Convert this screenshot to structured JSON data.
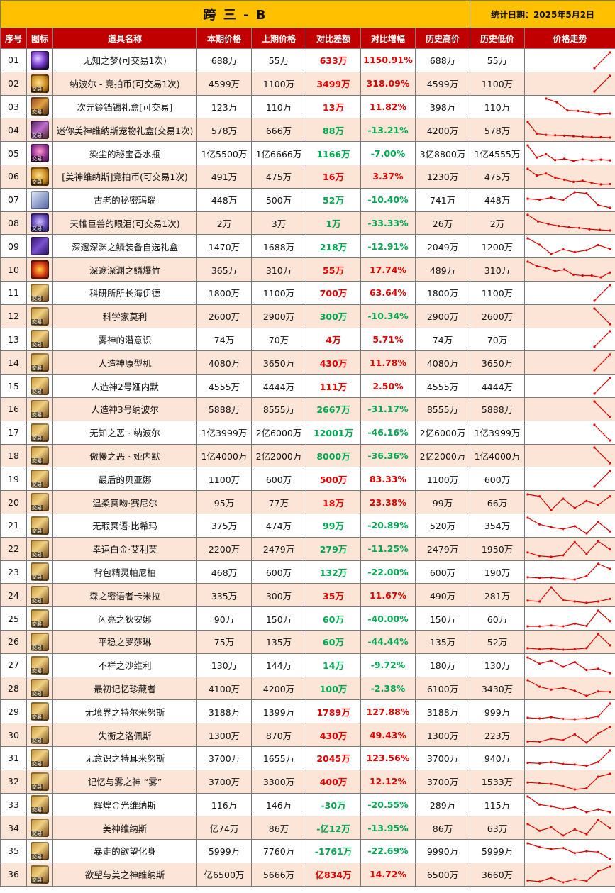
{
  "sheet": {
    "title": "跨 三 - B",
    "date_label": "统计日期：2025年5月2日"
  },
  "header": {
    "no": "序号",
    "icon": "图标",
    "name": "道具名称",
    "cur": "本期价格",
    "prev": "上期价格",
    "diff": "对比差额",
    "pct": "对比增幅",
    "high": "历史高价",
    "low": "历史低价",
    "trend": "价格走势"
  },
  "colors": {
    "up": "#e00000",
    "down": "#00a650",
    "header": "#c00000",
    "title": "#ffc000",
    "alt_row": "#fce4d6",
    "trend_line": "#e00000"
  },
  "icon_tag": "交易",
  "rows": [
    {
      "no": "01",
      "name": "无知之梦(可交易1次)",
      "cur": "688万",
      "prev": "55万",
      "diff": "633万",
      "pct": "1150.91%",
      "high": "688万",
      "low": "55万",
      "dir": "up",
      "icon": "orb-icon",
      "trend": [
        55,
        688
      ]
    },
    {
      "no": "02",
      "name": "纳波尔 - 竞拍币(可交易1次)",
      "cur": "4599万",
      "prev": "1100万",
      "diff": "3499万",
      "pct": "318.09%",
      "high": "4599万",
      "low": "1100万",
      "dir": "up",
      "icon": "coin-icon",
      "trend": [
        1100,
        4599
      ]
    },
    {
      "no": "03",
      "name": "次元铃铛镯礼盒[可交易]",
      "cur": "123万",
      "prev": "110万",
      "diff": "13万",
      "pct": "11.82%",
      "high": "398万",
      "low": "110万",
      "dir": "up",
      "icon": "box-icon",
      "trend": [
        398,
        330,
        180,
        170,
        140,
        110,
        123
      ]
    },
    {
      "no": "04",
      "name": "迷你美神维纳斯宠物礼盒(交易1次)",
      "cur": "578万",
      "prev": "666万",
      "diff": "88万",
      "pct": "-13.21%",
      "high": "4200万",
      "low": "578万",
      "dir": "down",
      "icon": "pet-box-icon",
      "trend": [
        4200,
        1500,
        1200,
        1100,
        1000,
        900,
        800,
        700,
        666,
        578
      ]
    },
    {
      "no": "05",
      "name": "染尘的秘宝香水瓶",
      "cur": "1亿5500万",
      "prev": "1亿6666万",
      "diff": "1166万",
      "pct": "-7.00%",
      "high": "3亿8800万",
      "low": "1亿4555万",
      "dir": "down",
      "icon": "bottle-icon",
      "trend": [
        38800,
        20000,
        25000,
        16000,
        18000,
        14555,
        17000,
        15500,
        16666,
        15500
      ]
    },
    {
      "no": "06",
      "name": "[美神维纳斯]竞拍币(可交易1次)",
      "cur": "491万",
      "prev": "475万",
      "diff": "16万",
      "pct": "3.37%",
      "high": "1230万",
      "low": "475万",
      "dir": "up",
      "icon": "coin-icon",
      "trend": [
        1230,
        900,
        1000,
        800,
        700,
        600,
        650,
        550,
        475,
        491
      ]
    },
    {
      "no": "07",
      "name": "古老的秘密玛瑙",
      "cur": "448万",
      "prev": "500万",
      "diff": "52万",
      "pct": "-10.40%",
      "high": "741万",
      "low": "448万",
      "dir": "down",
      "icon": "gem-icon",
      "trend": [
        620,
        600,
        640,
        590,
        741,
        720,
        500,
        448
      ]
    },
    {
      "no": "08",
      "name": "天帷巨兽的眼泪(可交易1次)",
      "cur": "2万",
      "prev": "3万",
      "diff": "1万",
      "pct": "-33.33%",
      "high": "26万",
      "low": "2万",
      "dir": "down",
      "icon": "tear-icon",
      "trend": [
        26,
        16,
        12,
        9,
        7,
        6,
        4,
        3,
        2
      ]
    },
    {
      "no": "09",
      "name": "深邃深渊之鳞装备自选礼盒",
      "cur": "1470万",
      "prev": "1688万",
      "diff": "218万",
      "pct": "-12.91%",
      "high": "2049万",
      "low": "1200万",
      "dir": "down",
      "icon": "chest-icon",
      "trend": [
        2049,
        1700,
        1200,
        1450,
        1300,
        1400,
        1688,
        1470
      ]
    },
    {
      "no": "10",
      "name": "深邃深渊之鳞爆竹",
      "cur": "365万",
      "prev": "310万",
      "diff": "55万",
      "pct": "17.74%",
      "high": "489万",
      "low": "310万",
      "dir": "up",
      "icon": "fire-icon",
      "trend": [
        489,
        440,
        420,
        380,
        400,
        340,
        330,
        330,
        310,
        365
      ]
    },
    {
      "no": "11",
      "name": "科研所所长海伊德",
      "cur": "1800万",
      "prev": "1100万",
      "diff": "700万",
      "pct": "63.64%",
      "high": "1800万",
      "low": "1100万",
      "dir": "up",
      "icon": "card-icon",
      "trend": [
        1100,
        1800
      ]
    },
    {
      "no": "12",
      "name": "科学家莫利",
      "cur": "2600万",
      "prev": "2900万",
      "diff": "300万",
      "pct": "-10.34%",
      "high": "2900万",
      "low": "2600万",
      "dir": "down",
      "icon": "card-icon",
      "trend": [
        2900,
        2600
      ]
    },
    {
      "no": "13",
      "name": "雾神的潜意识",
      "cur": "74万",
      "prev": "70万",
      "diff": "4万",
      "pct": "5.71%",
      "high": "74万",
      "low": "70万",
      "dir": "up",
      "icon": "card-icon",
      "trend": [
        70,
        74
      ]
    },
    {
      "no": "14",
      "name": "人造神原型机",
      "cur": "4080万",
      "prev": "3650万",
      "diff": "430万",
      "pct": "11.78%",
      "high": "4080万",
      "low": "3650万",
      "dir": "up",
      "icon": "card-icon",
      "trend": [
        3650,
        4080
      ]
    },
    {
      "no": "15",
      "name": "人造神2号娅内默",
      "cur": "4555万",
      "prev": "4444万",
      "diff": "111万",
      "pct": "2.50%",
      "high": "4555万",
      "low": "4444万",
      "dir": "up",
      "icon": "card-icon",
      "trend": [
        4444,
        4555
      ]
    },
    {
      "no": "16",
      "name": "人造神3号纳波尔",
      "cur": "5888万",
      "prev": "8555万",
      "diff": "2667万",
      "pct": "-31.17%",
      "high": "8555万",
      "low": "5888万",
      "dir": "down",
      "icon": "card-icon",
      "trend": [
        8555,
        5888
      ]
    },
    {
      "no": "17",
      "name": "无知之恶 · 纳波尔",
      "cur": "1亿3999万",
      "prev": "2亿6000万",
      "diff": "12001万",
      "pct": "-46.16%",
      "high": "2亿6000万",
      "low": "1亿3999万",
      "dir": "down",
      "icon": "card-icon",
      "trend": [
        26000,
        13999
      ]
    },
    {
      "no": "18",
      "name": "傲慢之恶 · 娅内默",
      "cur": "1亿4000万",
      "prev": "2亿2000万",
      "diff": "8000万",
      "pct": "-36.36%",
      "high": "2亿2000万",
      "low": "1亿4000万",
      "dir": "down",
      "icon": "card-icon",
      "trend": [
        22000,
        14000
      ]
    },
    {
      "no": "19",
      "name": "最后的贝亚娜",
      "cur": "1100万",
      "prev": "600万",
      "diff": "500万",
      "pct": "83.33%",
      "high": "1100万",
      "low": "600万",
      "dir": "up",
      "icon": "card-icon",
      "trend": [
        600,
        1100
      ]
    },
    {
      "no": "20",
      "name": "温柔冥吻·赛尼尔",
      "cur": "95万",
      "prev": "77万",
      "diff": "18万",
      "pct": "23.38%",
      "high": "99万",
      "low": "66万",
      "dir": "up",
      "icon": "card-icon",
      "trend": [
        99,
        95,
        66,
        90,
        70,
        85,
        77,
        95
      ]
    },
    {
      "no": "21",
      "name": "无瑕冥语·比希玛",
      "cur": "375万",
      "prev": "474万",
      "diff": "99万",
      "pct": "-20.89%",
      "high": "520万",
      "low": "354万",
      "dir": "down",
      "icon": "card-icon",
      "trend": [
        520,
        450,
        420,
        400,
        430,
        354,
        474,
        375
      ]
    },
    {
      "no": "22",
      "name": "幸运白金·艾利芙",
      "cur": "2200万",
      "prev": "2479万",
      "diff": "279万",
      "pct": "-11.25%",
      "high": "2479万",
      "low": "1950万",
      "dir": "down",
      "icon": "card-icon",
      "trend": [
        2100,
        1980,
        1950,
        2000,
        2450,
        2050,
        2479,
        2200
      ]
    },
    {
      "no": "23",
      "name": "背包精灵帕尼柏",
      "cur": "468万",
      "prev": "600万",
      "diff": "132万",
      "pct": "-22.00%",
      "high": "600万",
      "low": "190万",
      "dir": "down",
      "icon": "card-icon",
      "trend": [
        250,
        230,
        240,
        210,
        190,
        280,
        600,
        468
      ]
    },
    {
      "no": "24",
      "name": "森之密语者卡米拉",
      "cur": "335万",
      "prev": "300万",
      "diff": "35万",
      "pct": "11.67%",
      "high": "490万",
      "low": "281万",
      "dir": "up",
      "icon": "card-icon",
      "trend": [
        310,
        300,
        490,
        320,
        300,
        281,
        300,
        335
      ]
    },
    {
      "no": "25",
      "name": "闪亮之狄安娜",
      "cur": "90万",
      "prev": "150万",
      "diff": "60万",
      "pct": "-40.00%",
      "high": "150万",
      "low": "60万",
      "dir": "down",
      "icon": "card-icon",
      "trend": [
        60,
        60,
        65,
        60,
        75,
        62,
        150,
        90
      ]
    },
    {
      "no": "26",
      "name": "平稳之罗莎琳",
      "cur": "75万",
      "prev": "135万",
      "diff": "60万",
      "pct": "-44.44%",
      "high": "135万",
      "low": "52万",
      "dir": "down",
      "icon": "card-icon",
      "trend": [
        60,
        55,
        58,
        52,
        55,
        60,
        135,
        75
      ]
    },
    {
      "no": "27",
      "name": "不祥之沙维利",
      "cur": "130万",
      "prev": "144万",
      "diff": "14万",
      "pct": "-9.72%",
      "high": "180万",
      "low": "130万",
      "dir": "down",
      "icon": "card-icon",
      "trend": [
        180,
        160,
        170,
        150,
        165,
        140,
        144,
        130
      ]
    },
    {
      "no": "28",
      "name": "最初记忆珍藏者",
      "cur": "4100万",
      "prev": "4200万",
      "diff": "100万",
      "pct": "-2.38%",
      "high": "6100万",
      "low": "3430万",
      "dir": "down",
      "icon": "card-icon",
      "trend": [
        6100,
        5000,
        4500,
        4800,
        4300,
        3430,
        4200,
        4100
      ]
    },
    {
      "no": "29",
      "name": "无境界之特尔米努斯",
      "cur": "3188万",
      "prev": "1399万",
      "diff": "1789万",
      "pct": "127.88%",
      "high": "3188万",
      "low": "999万",
      "dir": "up",
      "icon": "card-icon",
      "trend": [
        1200,
        1100,
        1300,
        1050,
        999,
        1100,
        1399,
        3188
      ]
    },
    {
      "no": "30",
      "name": "失衡之洛佩斯",
      "cur": "1300万",
      "prev": "870万",
      "diff": "430万",
      "pct": "49.43%",
      "high": "1300万",
      "low": "223万",
      "dir": "up",
      "icon": "card-icon",
      "trend": [
        300,
        280,
        500,
        400,
        800,
        223,
        870,
        1300
      ]
    },
    {
      "no": "31",
      "name": "无意识之特耳米努斯",
      "cur": "3700万",
      "prev": "1655万",
      "diff": "2045万",
      "pct": "123.56%",
      "high": "3700万",
      "low": "940万",
      "dir": "up",
      "icon": "card-icon",
      "trend": [
        1500,
        1400,
        1600,
        1300,
        1200,
        940,
        1655,
        3700
      ]
    },
    {
      "no": "32",
      "name": "记忆与雾之神 “雾”",
      "cur": "3700万",
      "prev": "3300万",
      "diff": "400万",
      "pct": "12.12%",
      "high": "3700万",
      "low": "1533万",
      "dir": "up",
      "icon": "card-icon",
      "trend": [
        2500,
        2400,
        2300,
        2000,
        1533,
        1700,
        3300,
        3700
      ]
    },
    {
      "no": "33",
      "name": "辉煌金光维纳斯",
      "cur": "116万",
      "prev": "146万",
      "diff": "-30万",
      "pct": "-20.55%",
      "high": "289万",
      "low": "115万",
      "dir": "down",
      "icon": "card-icon",
      "trend": [
        289,
        200,
        180,
        150,
        170,
        115,
        146,
        116
      ]
    },
    {
      "no": "34",
      "name": "美神维纳斯",
      "cur": "亿74万",
      "prev": "86万",
      "diff": "-亿12万",
      "pct": "-13.95%",
      "high": "86万",
      "low": "63万",
      "dir": "down",
      "icon": "card-icon",
      "trend": [
        80,
        70,
        75,
        63,
        72,
        65,
        86,
        74
      ]
    },
    {
      "no": "35",
      "name": "暴走的欲望化身",
      "cur": "5999万",
      "prev": "7760万",
      "diff": "-1761万",
      "pct": "-22.69%",
      "high": "9990万",
      "low": "5999万",
      "dir": "down",
      "icon": "card-icon",
      "trend": [
        9990,
        9000,
        8500,
        8800,
        7500,
        8000,
        7760,
        5999
      ]
    },
    {
      "no": "36",
      "name": "欲望与美之神维纳斯",
      "cur": "亿6500万",
      "prev": "5666万",
      "diff": "亿834万",
      "pct": "14.72%",
      "high": "6500万",
      "low": "3660万",
      "dir": "up",
      "icon": "card-icon",
      "trend": [
        4000,
        3800,
        4500,
        3660,
        4200,
        3900,
        5666,
        6500
      ]
    }
  ]
}
